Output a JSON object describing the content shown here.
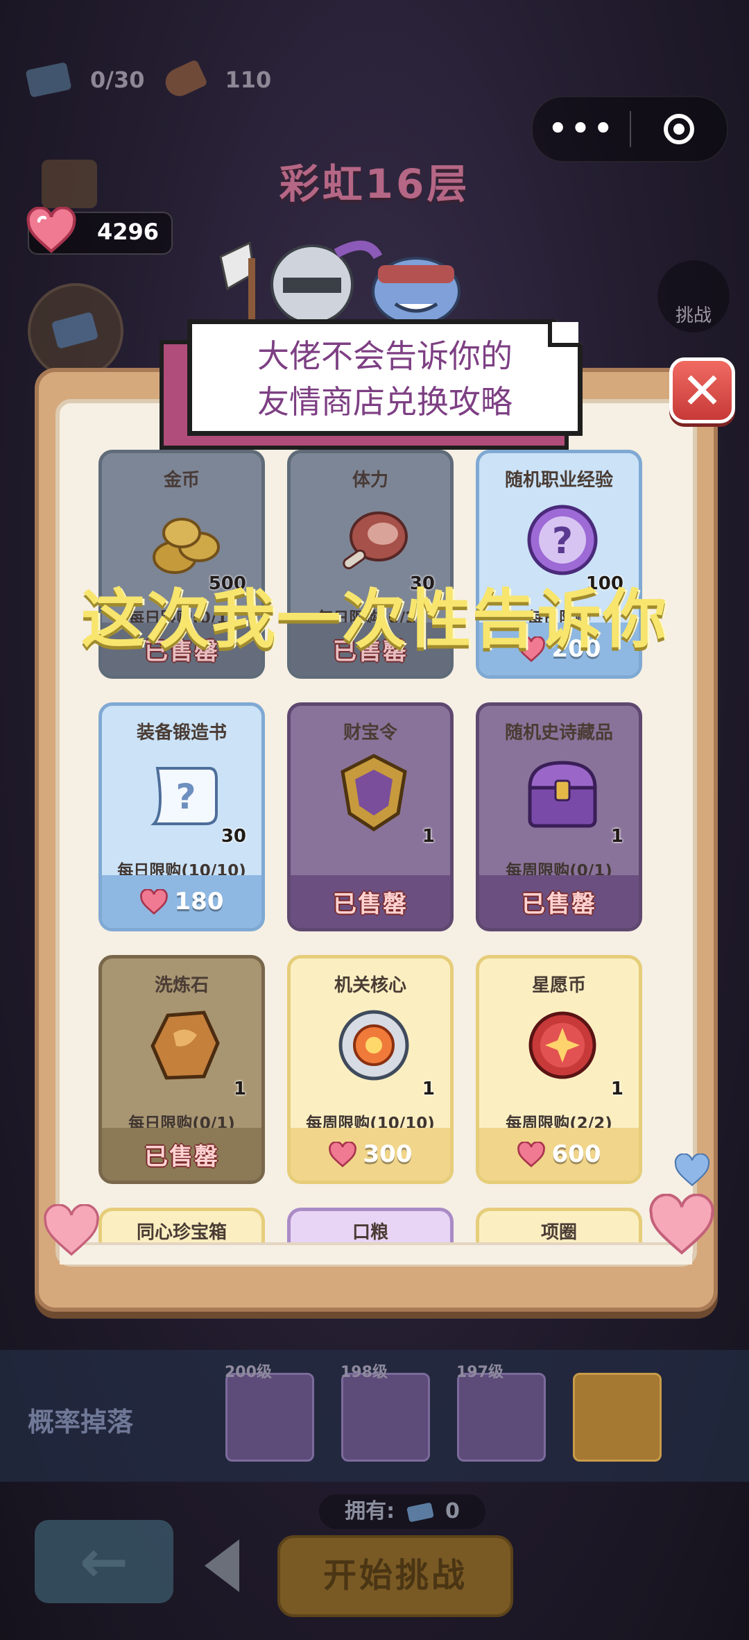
{
  "hud": {
    "ticket_count": "0/30",
    "stamina_count": "110",
    "capsule_menu_icon": "more-dots-icon",
    "capsule_close_icon": "target-circle-icon"
  },
  "floor_title": "彩虹16层",
  "hearts": {
    "value": "4296"
  },
  "side": {
    "challenge_label": "挑战"
  },
  "modal": {
    "banner_line1": "大佬不会告诉你的",
    "banner_line2": "友情商店兑换攻略",
    "overlay_caption": "这次我一次性告诉你",
    "close_icon": "close-x-icon"
  },
  "items": [
    {
      "name": "金币",
      "qty": "500",
      "limit": "每日限购(0/1)",
      "status": "已售罄",
      "theme": "grey",
      "icon": "gold-coins-icon"
    },
    {
      "name": "体力",
      "qty": "30",
      "limit": "每日限购(0/2)",
      "status": "已售罄",
      "theme": "grey",
      "icon": "meat-drumstick-icon"
    },
    {
      "name": "随机职业经验",
      "qty": "100",
      "limit": "每日限购",
      "price": "200",
      "theme": "blue",
      "icon": "mystery-orb-icon"
    },
    {
      "name": "装备锻造书",
      "qty": "30",
      "limit": "每日限购(10/10)",
      "price": "180",
      "theme": "blue",
      "icon": "mystery-scroll-icon"
    },
    {
      "name": "财宝令",
      "qty": "1",
      "limit": "",
      "status": "已售罄",
      "theme": "purple",
      "icon": "treasure-token-icon"
    },
    {
      "name": "随机史诗藏品",
      "qty": "1",
      "limit": "每周限购(0/1)",
      "status": "已售罄",
      "theme": "purple",
      "icon": "epic-chest-icon"
    },
    {
      "name": "洗炼石",
      "qty": "1",
      "limit": "每日限购(0/1)",
      "status": "已售罄",
      "theme": "olive",
      "icon": "refining-stone-icon"
    },
    {
      "name": "机关核心",
      "qty": "1",
      "limit": "每周限购(10/10)",
      "price": "300",
      "theme": "yellow",
      "icon": "mechanism-core-icon"
    },
    {
      "name": "星愿币",
      "qty": "1",
      "limit": "每周限购(2/2)",
      "price": "600",
      "theme": "yellow",
      "icon": "star-wish-coin-icon"
    },
    {
      "name": "同心珍宝箱",
      "theme": "cream"
    },
    {
      "name": "口粮",
      "theme": "lilac"
    },
    {
      "name": "项圈",
      "theme": "cream"
    }
  ],
  "drop": {
    "label": "概率掉落",
    "chests": [
      {
        "level": "200级"
      },
      {
        "level": "198级"
      },
      {
        "level": "197级"
      },
      {
        "level": ""
      }
    ]
  },
  "bottom": {
    "own_label": "拥有:",
    "own_value": "0",
    "start_label": "开始挑战"
  },
  "colors": {
    "banner_pink": "#b04d7a",
    "banner_text": "#7d3f83",
    "caption_yellow": "#f7e56e",
    "close_red": "#e0504c"
  }
}
